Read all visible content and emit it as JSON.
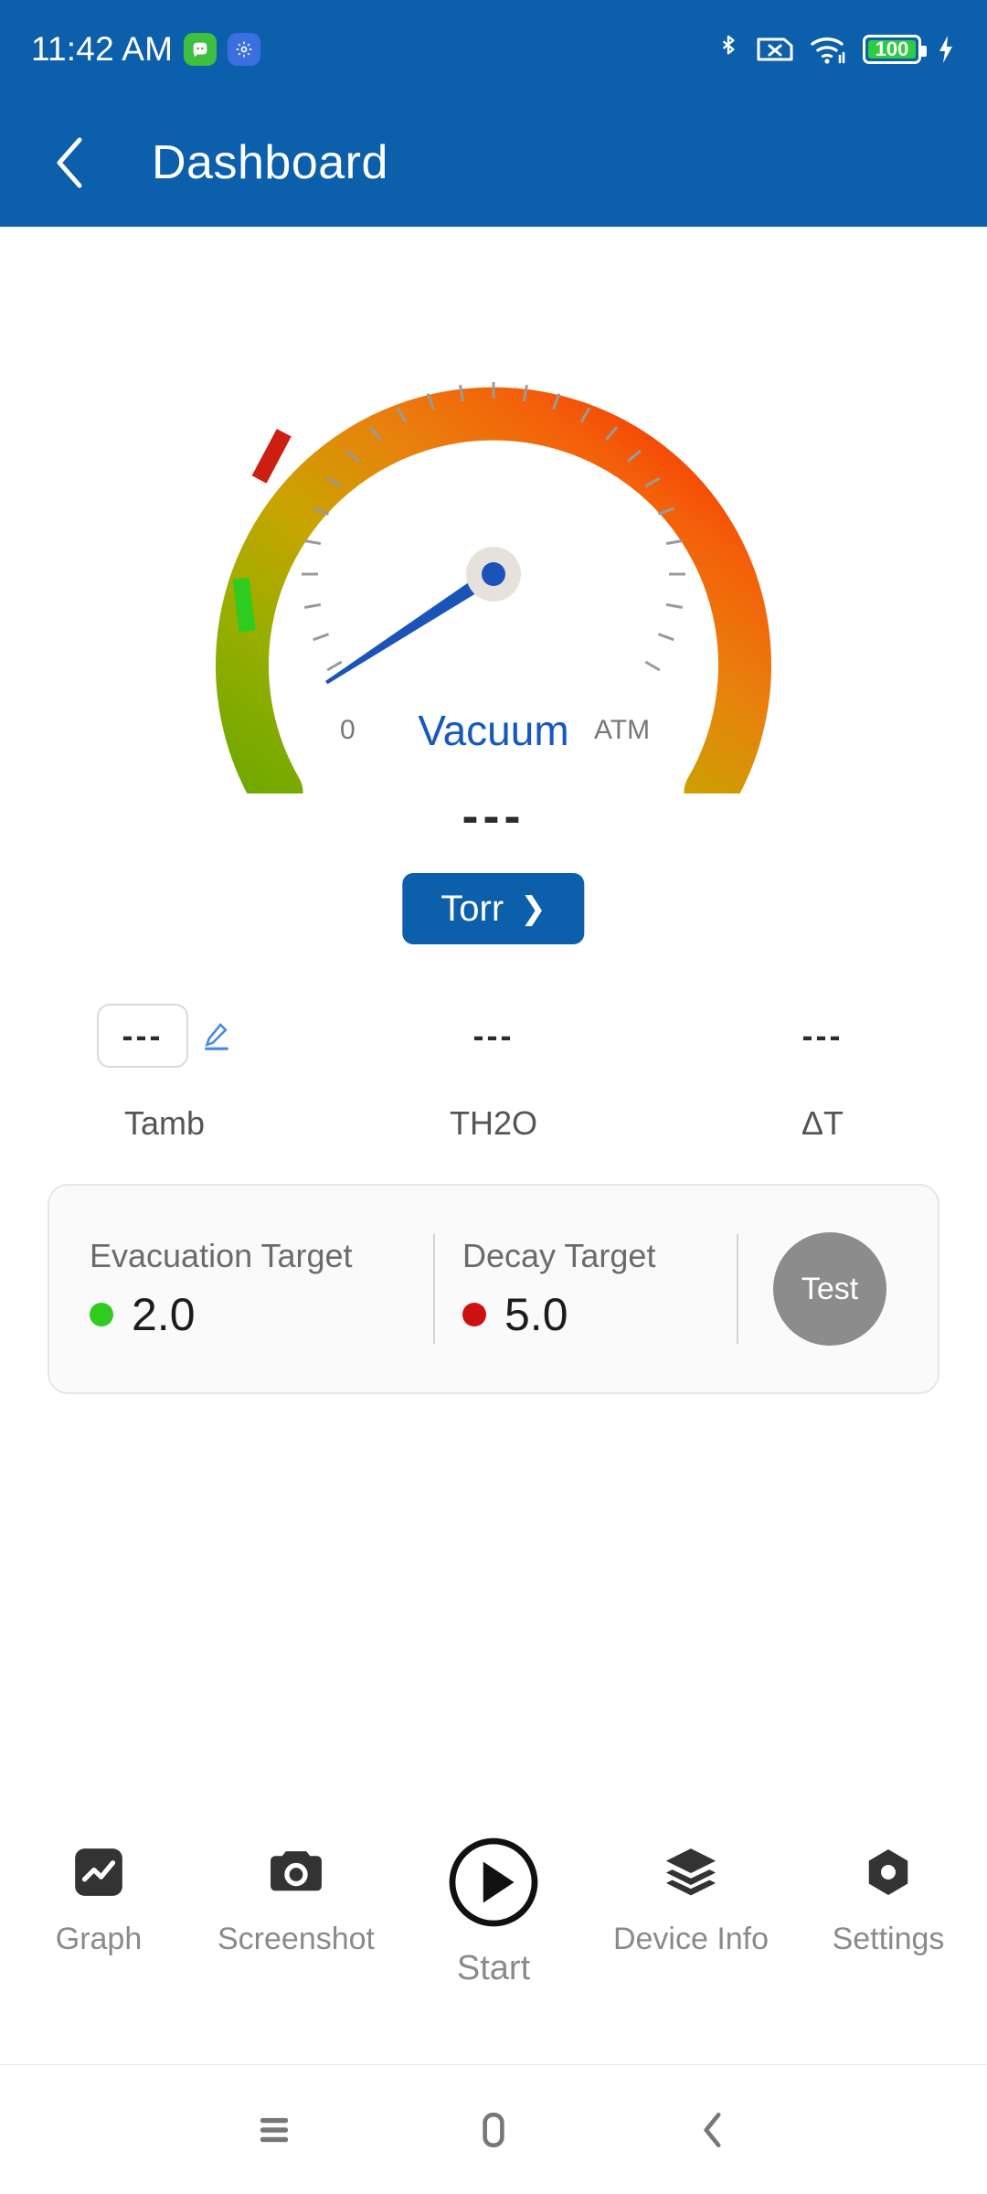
{
  "status_bar": {
    "time": "11:42 AM",
    "app_icons": [
      "chat-app-icon",
      "settings-app-icon"
    ],
    "icons": [
      "bluetooth-icon",
      "sim-card-off-icon",
      "wifi-icon",
      "battery-icon",
      "charging-icon"
    ],
    "battery_percent": "100"
  },
  "app_bar": {
    "back_label": "back",
    "title": "Dashboard"
  },
  "gauge": {
    "label": "Vacuum",
    "min_label": "0",
    "max_label": "ATM",
    "value_display": "---",
    "needle_angle_deg": 57,
    "evacuation_marker_angle_deg": -132,
    "decay_marker_angle_deg": -118,
    "arc_colors": {
      "start_green": "#6FA800",
      "mid_yellow": "#C9A400",
      "mid_orange": "#E8820C",
      "end_red": "#F42A00"
    },
    "evacuation_marker_color": "#2ECC1F",
    "decay_marker_color": "#CC1F11",
    "needle_color": "#1B54B8",
    "hub_color": "#E6E2DB"
  },
  "unit_button": {
    "label": "Torr",
    "chevron": "chevron-right-icon"
  },
  "metrics": [
    {
      "value": "---",
      "name": "Tamb",
      "editable": true,
      "edit_icon": "pencil-edit-icon"
    },
    {
      "value": "---",
      "name": "TH2O",
      "editable": false
    },
    {
      "value": "---",
      "name": "ΔT",
      "editable": false
    }
  ],
  "targets_card": {
    "evacuation": {
      "title": "Evacuation Target",
      "value": "2.0",
      "dot_color": "#2ECC1F"
    },
    "decay": {
      "title": "Decay Target",
      "value": "5.0",
      "dot_color": "#CC1111"
    },
    "test_button": {
      "label": "Test",
      "color": "#8c8c8c"
    }
  },
  "bottom_tabs": [
    {
      "label": "Graph",
      "icon": "chart-line-icon"
    },
    {
      "label": "Screenshot",
      "icon": "camera-icon"
    },
    {
      "label": "Start",
      "icon": "play-circle-icon"
    },
    {
      "label": "Device Info",
      "icon": "layers-icon"
    },
    {
      "label": "Settings",
      "icon": "hexagon-gear-icon"
    }
  ],
  "system_nav": [
    {
      "name": "recents-icon"
    },
    {
      "name": "home-icon"
    },
    {
      "name": "back-icon"
    }
  ],
  "theme": {
    "primary_blue": "#0B5FAB",
    "accent_blue": "#1558C0",
    "muted_gray": "#8a8a8a"
  }
}
